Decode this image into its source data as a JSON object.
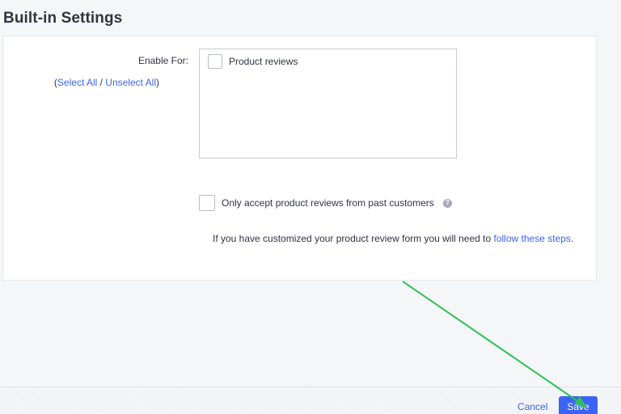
{
  "section": {
    "title": "Built-in Settings"
  },
  "enable_for": {
    "label": "Enable For:",
    "open_paren": "(",
    "select_all": "Select All",
    "separator": " / ",
    "unselect_all": "Unselect All",
    "close_paren": ")",
    "options": [
      {
        "label": "Product reviews",
        "checked": false
      }
    ]
  },
  "past_customers": {
    "label": "Only accept product reviews from past customers",
    "checked": false,
    "help_icon": "?"
  },
  "info": {
    "text": "If you have customized your product review form you will need to ",
    "link": "follow these steps",
    "suffix": "."
  },
  "footer": {
    "cancel_label": "Cancel",
    "save_label": "Save"
  },
  "colors": {
    "accent": "#3c64f4",
    "annotation_arrow": "#2fbf5a"
  }
}
